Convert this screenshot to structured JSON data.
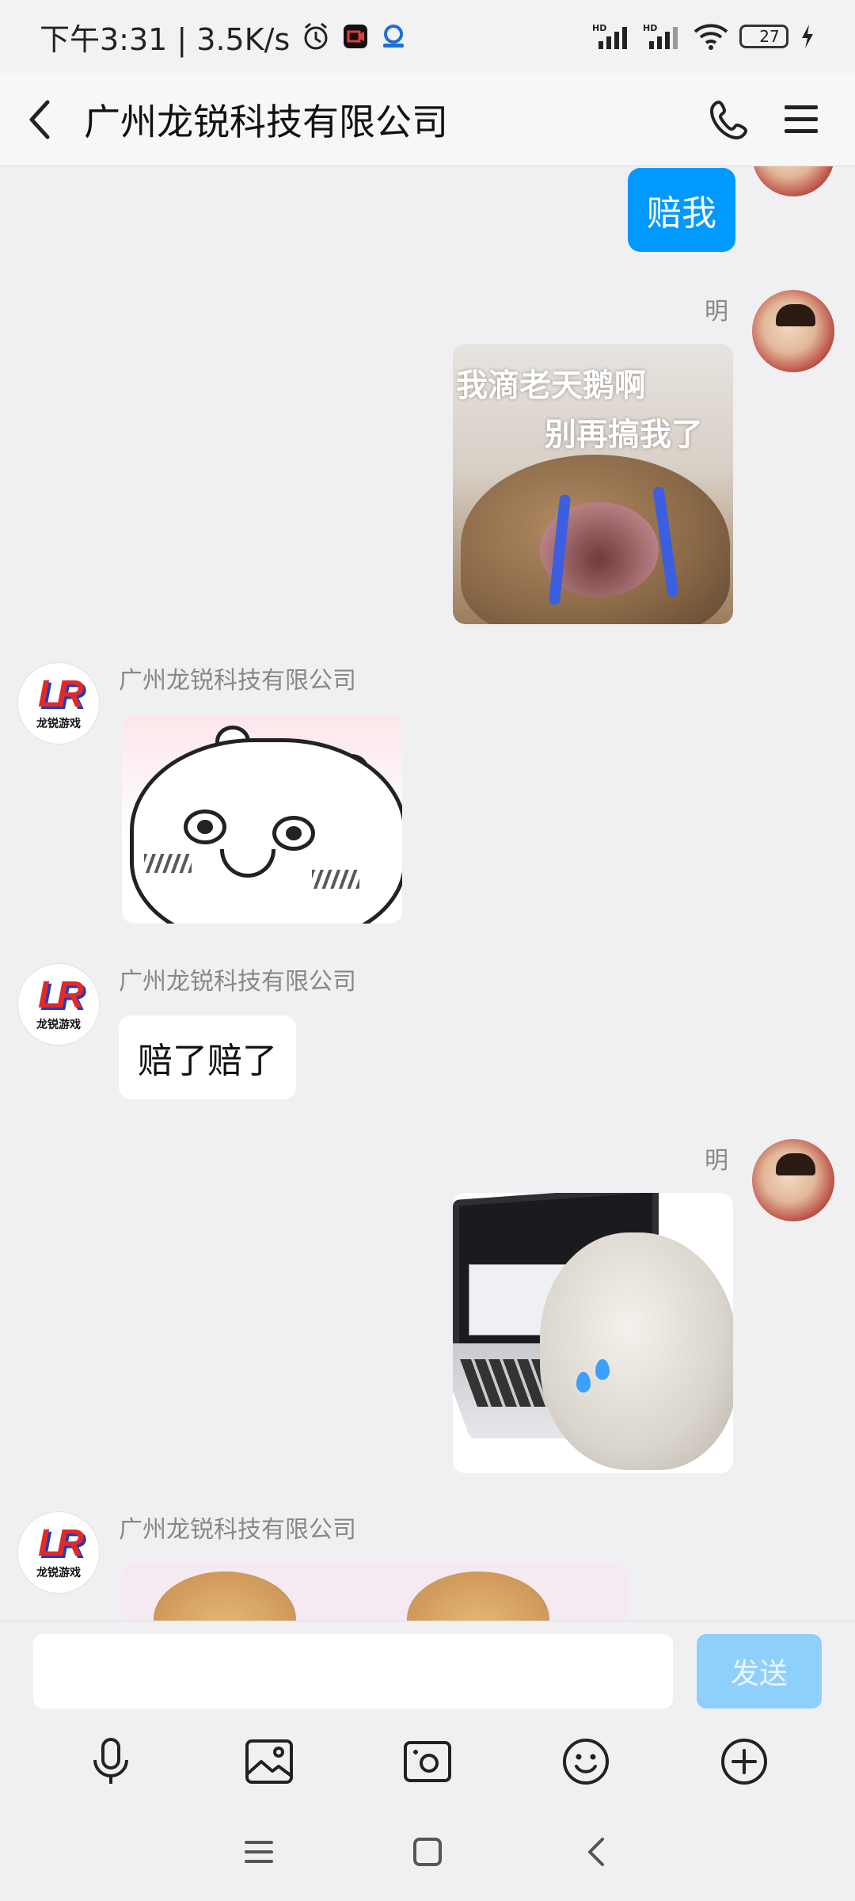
{
  "status_bar": {
    "time_speed": "下午3:31 | 3.5K/s",
    "battery": "27",
    "icons": [
      "alarm-icon",
      "video-app-icon",
      "app-icon",
      "hd-signal-icon",
      "hd-signal-icon",
      "wifi-icon",
      "battery-icon",
      "charging-icon"
    ]
  },
  "header": {
    "title": "广州龙锐科技有限公司",
    "icons": [
      "back-icon",
      "phone-icon",
      "menu-icon"
    ]
  },
  "messages": [
    {
      "from": "self",
      "type": "text",
      "text": "赔我"
    },
    {
      "from": "self",
      "sender": "明",
      "type": "sticker",
      "caption_line1": "我滴老天鹅啊",
      "caption_line2": "别再搞我了"
    },
    {
      "from": "other",
      "sender": "广州龙锐科技有限公司",
      "type": "sticker"
    },
    {
      "from": "other",
      "sender": "广州龙锐科技有限公司",
      "type": "text",
      "text": "赔了赔了"
    },
    {
      "from": "self",
      "sender": "明",
      "type": "sticker"
    },
    {
      "from": "other",
      "sender": "广州龙锐科技有限公司",
      "type": "sticker"
    }
  ],
  "other_avatar": {
    "mark": "LR",
    "sub": "龙锐游戏"
  },
  "input": {
    "value": "",
    "placeholder": "",
    "send_label": "发送"
  },
  "toolbar": {
    "icons": [
      "microphone-icon",
      "image-icon",
      "camera-icon",
      "emoji-icon",
      "plus-icon"
    ]
  },
  "nav": {
    "icons": [
      "recents-icon",
      "home-icon",
      "back-nav-icon"
    ]
  },
  "colors": {
    "accent": "#0099ff",
    "send_disabled": "#8fd0fb",
    "background": "#f0f0f2"
  }
}
